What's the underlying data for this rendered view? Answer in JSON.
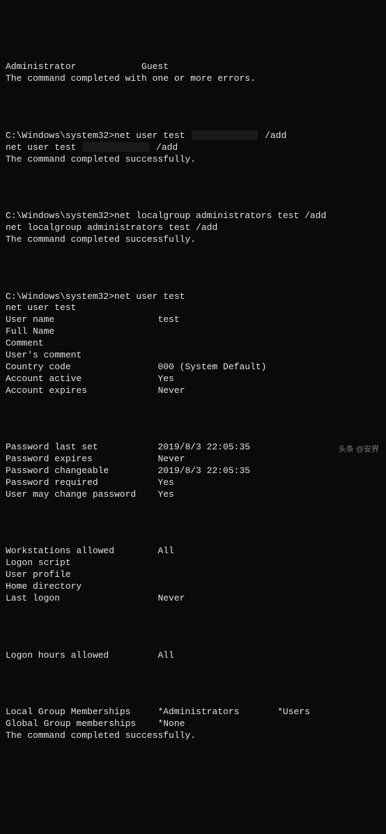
{
  "header": {
    "accounts_line": "Administrator            Guest",
    "err": "The command completed with one or more errors."
  },
  "cmd1": {
    "prompt": "C:\\Windows\\system32>",
    "cmd_pre": "net user test ",
    "cmd_post": " /add",
    "echo_pre": "net user test ",
    "echo_post": " /add",
    "done": "The command completed successfully."
  },
  "cmd2": {
    "prompt": "C:\\Windows\\system32>",
    "cmd": "net localgroup administrators test /add",
    "echo": "net localgroup administrators test /add",
    "done": "The command completed successfully."
  },
  "cmd3": {
    "prompt": "C:\\Windows\\system32>",
    "cmd": "net user test",
    "echo": "net user test"
  },
  "props1": {
    "k1": "User name",
    "v1": "test",
    "k2": "Full Name",
    "v2": "",
    "k3": "Comment",
    "v3": "",
    "k4": "User's comment",
    "v4": "",
    "k5": "Country code",
    "v5": "000 (System Default)",
    "k6": "Account active",
    "v6": "Yes",
    "k7": "Account expires",
    "v7": "Never"
  },
  "props2": {
    "k1": "Password last set",
    "v1": "2019/8/3 22:05:35",
    "k2": "Password expires",
    "v2": "Never",
    "k3": "Password changeable",
    "v3": "2019/8/3 22:05:35",
    "k4": "Password required",
    "v4": "Yes",
    "k5": "User may change password",
    "v5": "Yes"
  },
  "props3": {
    "k1": "Workstations allowed",
    "v1": "All",
    "k2": "Logon script",
    "v2": "",
    "k3": "User profile",
    "v3": "",
    "k4": "Home directory",
    "v4": "",
    "k5": "Last logon",
    "v5": "Never"
  },
  "props4": {
    "k1": "Logon hours allowed",
    "v1": "All"
  },
  "groups": {
    "k1": "Local Group Memberships",
    "v1a": "*Administrators",
    "v1b": "*Users",
    "k2": "Global Group memberships",
    "v2": "*None",
    "done": "The command completed successfully."
  },
  "watermark": "头条 @安界"
}
